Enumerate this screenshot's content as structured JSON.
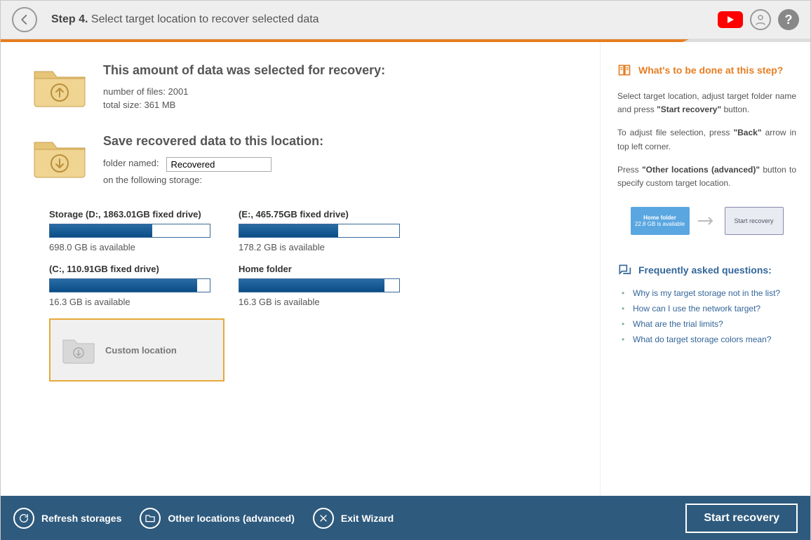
{
  "header": {
    "step_prefix": "Step 4.",
    "step_title": "Select target location to recover selected data"
  },
  "summary": {
    "heading": "This amount of data was selected for recovery:",
    "files_label": "number of files: 2001",
    "size_label": "total size: 361 MB"
  },
  "save": {
    "heading": "Save recovered data to this location:",
    "folder_label": "folder named:",
    "folder_value": "Recovered",
    "storage_label": "on the following storage:"
  },
  "storages": [
    {
      "title": "Storage (D:, 1863.01GB fixed drive)",
      "available": "698.0 GB is available",
      "fill": 64
    },
    {
      "title": "(E:, 465.75GB fixed drive)",
      "available": "178.2 GB is available",
      "fill": 62
    },
    {
      "title": "(С:, 110.91GB fixed drive)",
      "available": "16.3 GB is available",
      "fill": 92
    },
    {
      "title": "Home folder",
      "available": "16.3 GB is available",
      "fill": 91
    }
  ],
  "custom": {
    "label": "Custom location"
  },
  "sidebar": {
    "title": "What's to be done at this step?",
    "p1_a": "Select target location, adjust target folder name and press ",
    "p1_b": "\"Start recovery\"",
    "p1_c": " button.",
    "p2_a": "To adjust file selection, press ",
    "p2_b": "\"Back\"",
    "p2_c": " arrow in top left corner.",
    "p3_a": "Press ",
    "p3_b": "\"Other locations (advanced)\"",
    "p3_c": " button to specify custom target location.",
    "hint_box1_t": "Home folder",
    "hint_box1_s": "22.8 GB is available",
    "hint_box2": "Start recovery",
    "faq_title": "Frequently asked questions:",
    "faq": [
      "Why is my target storage not in the list?",
      "How can I use the network target?",
      "What are the trial limits?",
      "What do target storage colors mean?"
    ]
  },
  "footer": {
    "refresh": "Refresh storages",
    "other": "Other locations (advanced)",
    "exit": "Exit Wizard",
    "start": "Start recovery"
  }
}
